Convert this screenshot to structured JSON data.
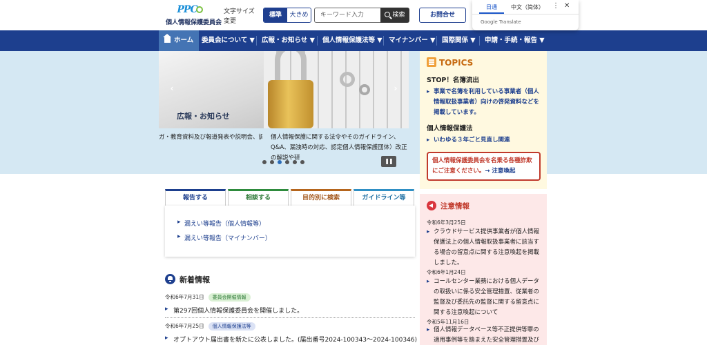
{
  "header": {
    "logo_mark": "PPC",
    "logo_text": "個人情報保護委員会",
    "font_size_label": "文字サイズ変更",
    "font_size_buttons": [
      "標準",
      "大きめ"
    ],
    "search_placeholder": "キーワード入力",
    "search_button": "検索",
    "contact_button": "お問合せ"
  },
  "translate": {
    "tabs": [
      "日通",
      "中文（简体）"
    ],
    "more": "⋮",
    "close": "✕",
    "brand": "Google Translate"
  },
  "nav": {
    "items": [
      "ホーム",
      "委員会について ▼",
      "広報・お知らせ ▼",
      "個人情報保護法等 ▼",
      "マイナンバー ▼",
      "国際関係 ▼",
      "申請・手続・報告 ▼"
    ]
  },
  "carousel": {
    "slide_title": "広報・お知らせ",
    "caption_left": "ガ・教育資料及び報道発表や説明会、調",
    "caption_right": "個人情報保護に関する法令やそのガイドライン、Q&A、漏洩時の対応、認定個人情報保護団体）改正の解説や研",
    "prev": "‹",
    "next": "›",
    "pause": "❚❚",
    "dot_count": 6,
    "active_dot": 2
  },
  "topics": {
    "heading": "TOPICS",
    "groups": [
      {
        "title": "STOP！名簿流出",
        "links": [
          "事業で名簿を利用している事業者（個人情報取扱事業者）向けの啓発資料などを掲載しています。"
        ]
      },
      {
        "title": "個人情報保護法",
        "links": [
          "いわゆる３年ごと見直し関連"
        ]
      }
    ],
    "alert": "個人情報保護委員会を名乗る各種詐欺にご注意ください。",
    "alert_link": "→ 注意喚起"
  },
  "caution": {
    "heading": "注意情報",
    "items": [
      {
        "date": "令和6年3月25日",
        "text": "クラウドサービス提供事業者が個人情報保護法上の個人情報取扱事業者に該当する場合の留意点に関する注意喚起を掲載しました。"
      },
      {
        "date": "令和6年1月24日",
        "text": "コールセンター業務における個人データの取扱いに係る安全管理措置、従業者の監督及び委託先の監督に関する留意点に関する注意喚起について"
      },
      {
        "date": "令和5年11月16日",
        "text": "個人情報データベース等不正提供等罪の適用事例等を踏まえた安全管理措置及び漏え"
      }
    ]
  },
  "tabs": {
    "labels": [
      "報告する",
      "相談する",
      "目的別に検索",
      "ガイドライン等"
    ],
    "links": [
      "漏えい等報告（個人情報等）",
      "漏えい等報告（マイナンバー）"
    ]
  },
  "news": {
    "heading": "新着情報",
    "items": [
      {
        "date": "令和6年7月31日",
        "badge": "委員会開催情報",
        "text": "第297回個人情報保護委員会を開催しました。"
      },
      {
        "date": "令和6年7月25日",
        "badge": "個人情報保護法等",
        "text": "オプトアウト届出書を新たに公表しました。(届出番号2024-100343～2024-100346)"
      }
    ]
  }
}
